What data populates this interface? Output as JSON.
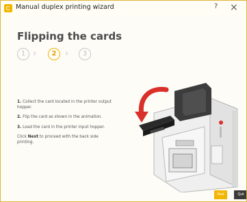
{
  "window": {
    "title": "Manual duplex printing wizard",
    "help_label": "?",
    "close_label": "×"
  },
  "heading": "Flipping the cards",
  "steps": [
    {
      "label": "1",
      "active": false
    },
    {
      "label": "2",
      "active": true
    },
    {
      "label": "3",
      "active": false
    }
  ],
  "step_separator": "›",
  "instructions": {
    "step1_num": "1.",
    "step1_text": "Collect the card located in the printer output hopper.",
    "step2_num": "2.",
    "step2_text": "Flip the card as shown in the animation.",
    "step3_num": "3.",
    "step3_text": "Load the card in the printer input hopper.",
    "click_text": "Click",
    "click_bold": "Next",
    "click_rest": "to proceed with the back side printing."
  },
  "buttons": {
    "next": "Next",
    "quit": "Quit"
  },
  "colors": {
    "accent": "#f2b500",
    "arrow": "#d9302a",
    "quit_bg": "#3a3a3a"
  }
}
